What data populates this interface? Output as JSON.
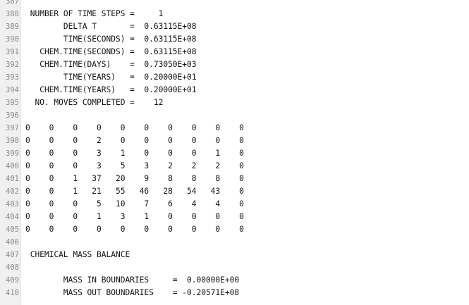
{
  "lines": [
    {
      "num": "387",
      "text": ""
    },
    {
      "num": "388",
      "text": " NUMBER OF TIME STEPS =     1"
    },
    {
      "num": "389",
      "text": "        DELTA T       =  0.63115E+08"
    },
    {
      "num": "390",
      "text": "        TIME(SECONDS) =  0.63115E+08"
    },
    {
      "num": "391",
      "text": "   CHEM.TIME(SECONDS) =  0.63115E+08"
    },
    {
      "num": "392",
      "text": "   CHEM.TIME(DAYS)    =  0.73050E+03"
    },
    {
      "num": "393",
      "text": "        TIME(YEARS)   =  0.20000E+01"
    },
    {
      "num": "394",
      "text": "   CHEM.TIME(YEARS)   =  0.20000E+01"
    },
    {
      "num": "395",
      "text": "  NO. MOVES COMPLETED =    12"
    },
    {
      "num": "396",
      "text": ""
    },
    {
      "num": "397",
      "text": "0    0    0    0    0    0    0    0    0    0"
    },
    {
      "num": "398",
      "text": "0    0    0    2    0    0    0    0    0    0"
    },
    {
      "num": "399",
      "text": "0    0    0    3    1    0    0    0    1    0"
    },
    {
      "num": "400",
      "text": "0    0    0    3    5    3    2    2    2    0"
    },
    {
      "num": "401",
      "text": "0    0    1   37   20    9    8    8    8    0"
    },
    {
      "num": "402",
      "text": "0    0    1   21   55   46   28   54   43    0"
    },
    {
      "num": "403",
      "text": "0    0    0    5   10    7    6    4    4    0"
    },
    {
      "num": "404",
      "text": "0    0    0    1    3    1    0    0    0    0"
    },
    {
      "num": "405",
      "text": "0    0    0    0    0    0    0    0    0    0"
    },
    {
      "num": "406",
      "text": ""
    },
    {
      "num": "407",
      "text": " CHEMICAL MASS BALANCE"
    },
    {
      "num": "408",
      "text": ""
    },
    {
      "num": "409",
      "text": "        MASS IN BOUNDARIES     =  0.00000E+00"
    },
    {
      "num": "410",
      "text": "        MASS OUT BOUNDARIES    = -0.20571E+08"
    }
  ]
}
